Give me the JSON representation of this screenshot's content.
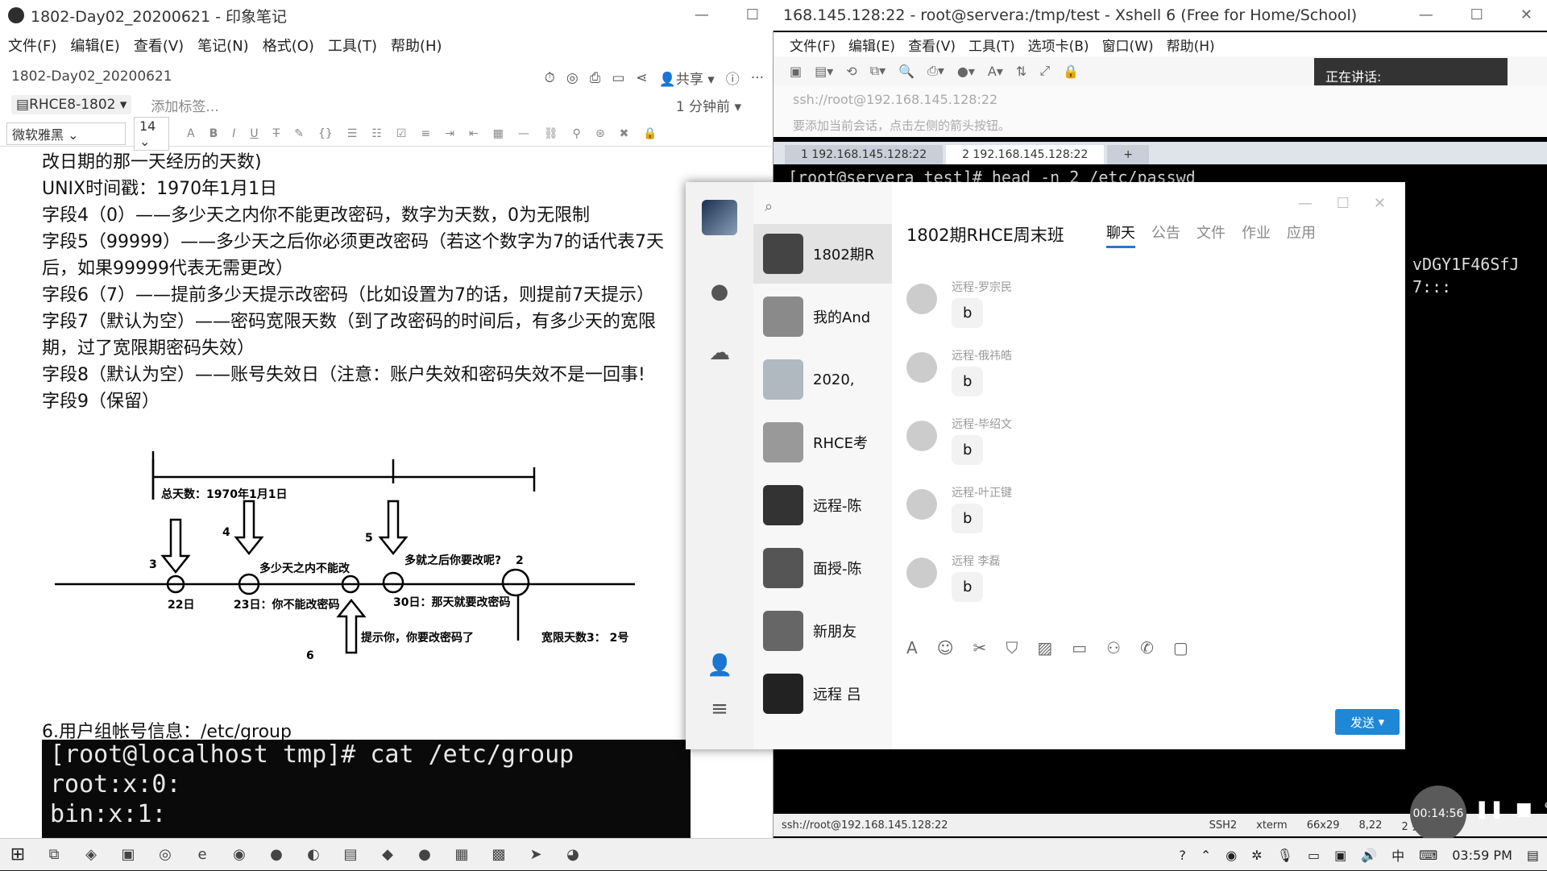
{
  "evernote": {
    "title": "1802-Day02_20200621 - 印象笔记",
    "menu": [
      "文件(F)",
      "编辑(E)",
      "查看(V)",
      "笔记(N)",
      "格式(O)",
      "工具(T)",
      "帮助(H)"
    ],
    "note_name": "1802-Day02_20200621",
    "share_label": "共享",
    "notebook": "RHCE8-1802",
    "add_tag": "添加标签...",
    "modified": "1 分钟前",
    "font_family": "微软雅黑",
    "font_size": "14",
    "lines": [
      "改日期的那一天经历的天数)",
      "UNIX时间戳：1970年1月1日",
      "字段4（0）——多少天之内你不能更改密码，数字为天数，0为无限制",
      "字段5（99999）——多少天之后你必须更改密码（若这个数字为7的话代表7天",
      "后，如果99999代表无需更改）",
      "字段6（7）——提前多少天提示改密码（比如设置为7的话，则提前7天提示）",
      "字段7（默认为空）——密码宽限天数（到了改密码的时间后，有多少天的宽限",
      "期，过了宽限期密码失效）",
      "字段8（默认为空）——账号失效日（注意：账户失效和密码失效不是一回事!",
      "字段9（保留）"
    ],
    "diagram": {
      "total_days": "总天数：1970年1月1日",
      "n3": "3",
      "n4": "4",
      "n5": "5",
      "n2": "2",
      "n6": "6",
      "cannot_change": "多少天之内不能改",
      "must_change": "多就之后你要改呢?",
      "d22": "22日",
      "d23": "23日：你不能改密码",
      "d30": "30日：那天就要改密码",
      "remind": "提示你，你要改密码了",
      "grace": "宽限天数3：  2号"
    },
    "section_group": "6.用户组帐号信息：/etc/group",
    "terminal": [
      "[root@localhost tmp]# cat /etc/group",
      "root:x:0:",
      "bin:x:1:"
    ]
  },
  "xshell": {
    "title": "168.145.128:22 - root@servera:/tmp/test - Xshell 6 (Free for Home/School)",
    "menu": [
      "文件(F)",
      "编辑(E)",
      "查看(V)",
      "工具(T)",
      "选项卡(B)",
      "窗口(W)",
      "帮助(H)"
    ],
    "speaking": "正在讲话:",
    "address": "ssh://root@192.168.145.128:22",
    "hint": "要添加当前会话，点击左侧的箭头按钮。",
    "tabs": [
      "1 192.168.145.128:22",
      "2 192.168.145.128:22"
    ],
    "terminal": [
      "[root@servera test]# head -n 2 /etc/passwd"
    ],
    "term_right1": "vDGY1F46SfJ",
    "term_right2": "7:::",
    "status": {
      "conn": "ssh://root@192.168.145.128:22",
      "proto": "SSH2",
      "term": "xterm",
      "size": "66x29",
      "pos": "8,22",
      "sessions": "2 会话"
    }
  },
  "qq": {
    "group_title": "1802期RHCE周末班",
    "tabs": [
      "聊天",
      "公告",
      "文件",
      "作业",
      "应用"
    ],
    "conversations": [
      "1802期R",
      "我的And",
      "2020,",
      "RHCE考",
      "远程-陈",
      "面授-陈",
      "新朋友",
      "远程 吕"
    ],
    "messages": [
      {
        "sender": "远程-罗宗民",
        "text": "b"
      },
      {
        "sender": "远程-俄祎皓",
        "text": "b"
      },
      {
        "sender": "远程-毕绍文",
        "text": "b"
      },
      {
        "sender": "远程-叶正键",
        "text": "b"
      },
      {
        "sender": "远程 李磊",
        "text": "b"
      }
    ],
    "send_label": "发送"
  },
  "recorder": {
    "time": "00:14:56"
  },
  "taskbar": {
    "time": "03:59 PM",
    "ime": "中"
  }
}
